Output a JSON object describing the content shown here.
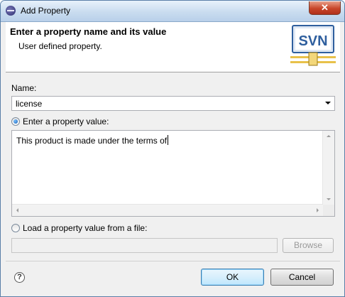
{
  "window": {
    "title": "Add Property",
    "close_symbol": "✕"
  },
  "banner": {
    "title": "Enter a property name and its value",
    "description": "User defined property.",
    "logo_text": "SVN"
  },
  "form": {
    "name_label": "Name:",
    "name_value": "license",
    "value_radio_label": "Enter a property value:",
    "value_text": "This product is made under the terms of",
    "file_radio_label": "Load a property value from a file:",
    "file_path": "",
    "browse_label": "Browse"
  },
  "footer": {
    "help_symbol": "?",
    "ok_label": "OK",
    "cancel_label": "Cancel"
  },
  "colors": {
    "accent": "#3c7fb1",
    "svn_blue": "#2f5f9e",
    "svn_gold": "#e8c14a"
  }
}
